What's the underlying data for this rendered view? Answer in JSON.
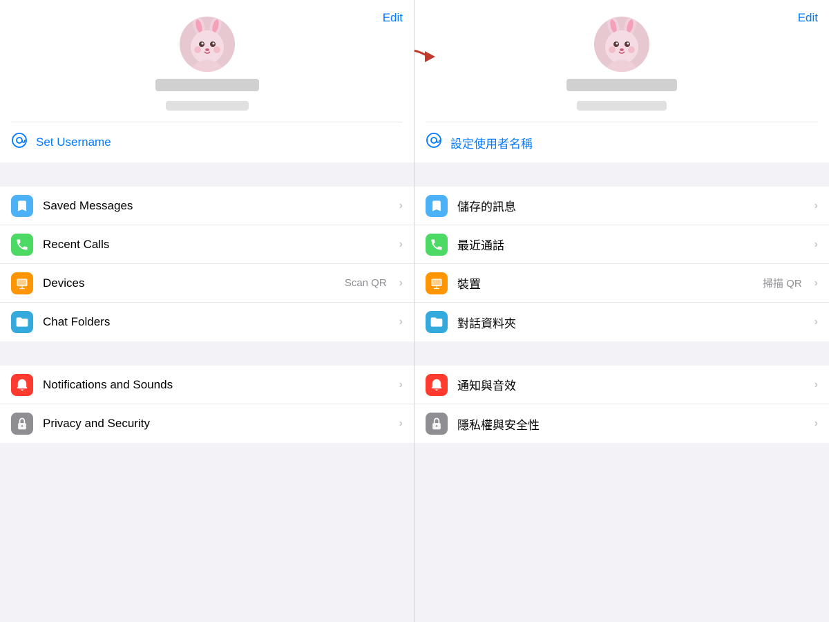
{
  "left": {
    "edit_label": "Edit",
    "username_icon": "👤",
    "username_label": "Set Username",
    "menu_groups": [
      {
        "items": [
          {
            "id": "saved-messages",
            "label": "Saved Messages",
            "icon": "saved",
            "icon_class": "icon-blue",
            "hint": "",
            "chevron": "›"
          },
          {
            "id": "recent-calls",
            "label": "Recent Calls",
            "icon": "phone",
            "icon_class": "icon-green",
            "hint": "",
            "chevron": "›"
          },
          {
            "id": "devices",
            "label": "Devices",
            "icon": "device",
            "icon_class": "icon-orange",
            "hint": "Scan QR",
            "chevron": "›"
          },
          {
            "id": "chat-folders",
            "label": "Chat Folders",
            "icon": "folder",
            "icon_class": "icon-teal",
            "hint": "",
            "chevron": "›"
          }
        ]
      },
      {
        "items": [
          {
            "id": "notifications",
            "label": "Notifications and Sounds",
            "icon": "bell",
            "icon_class": "icon-red",
            "hint": "",
            "chevron": "›"
          },
          {
            "id": "privacy",
            "label": "Privacy and Security",
            "icon": "lock",
            "icon_class": "icon-gray",
            "hint": "",
            "chevron": "›"
          }
        ]
      }
    ]
  },
  "right": {
    "edit_label": "Edit",
    "username_icon": "👤",
    "username_label": "設定使用者名稱",
    "menu_groups": [
      {
        "items": [
          {
            "id": "saved-messages-zh",
            "label": "儲存的訊息",
            "icon": "saved",
            "icon_class": "icon-blue",
            "hint": "",
            "chevron": "›"
          },
          {
            "id": "recent-calls-zh",
            "label": "最近通話",
            "icon": "phone",
            "icon_class": "icon-green",
            "hint": "",
            "chevron": "›"
          },
          {
            "id": "devices-zh",
            "label": "裝置",
            "icon": "device",
            "icon_class": "icon-orange",
            "hint": "掃描 QR",
            "chevron": "›"
          },
          {
            "id": "chat-folders-zh",
            "label": "對話資料夾",
            "icon": "folder",
            "icon_class": "icon-teal",
            "hint": "",
            "chevron": "›"
          }
        ]
      },
      {
        "items": [
          {
            "id": "notifications-zh",
            "label": "通知與音效",
            "icon": "bell",
            "icon_class": "icon-red",
            "hint": "",
            "chevron": "›"
          },
          {
            "id": "privacy-zh",
            "label": "隱私權與安全性",
            "icon": "lock",
            "icon_class": "icon-gray",
            "hint": "",
            "chevron": "›"
          }
        ]
      }
    ]
  }
}
